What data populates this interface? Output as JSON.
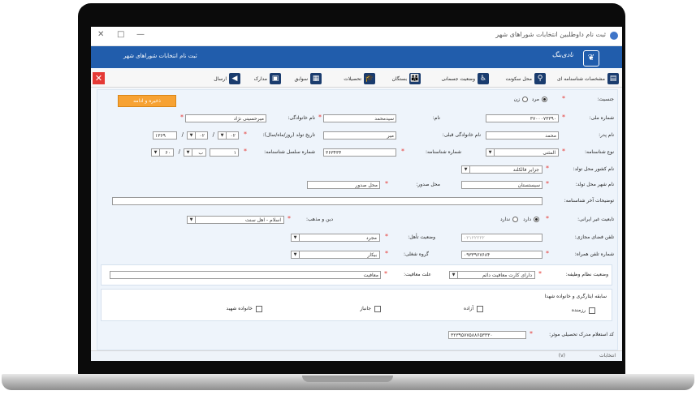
{
  "window": {
    "title": "ثبت نام داوطلبین انتخابات شوراهای شهر",
    "minimize": "—",
    "maximize": "□",
    "close": "✕"
  },
  "banner": {
    "title": "ثبت نام انتخابات شوراهای شهر",
    "logo_text": "نادی‌بنگ"
  },
  "tabs": [
    {
      "label": "مشخصات شناسنامه ای",
      "icon": "id-card-icon",
      "glyph": "▤"
    },
    {
      "label": "محل سکونت",
      "icon": "location-pin-icon",
      "glyph": "⚲"
    },
    {
      "label": "وضعیت جسمانی",
      "icon": "person-icon",
      "glyph": "♿"
    },
    {
      "label": "بستگان",
      "icon": "family-icon",
      "glyph": "👪"
    },
    {
      "label": "تحصیلات",
      "icon": "graduation-cap-icon",
      "glyph": "🎓"
    },
    {
      "label": "سوابق",
      "icon": "records-icon",
      "glyph": "▦"
    },
    {
      "label": "مدارک",
      "icon": "documents-icon",
      "glyph": "▣"
    },
    {
      "label": "ارسال",
      "icon": "send-icon",
      "glyph": "◀"
    }
  ],
  "close_form_label": "✕",
  "save_button": "ذخیره و ادامه",
  "fields": {
    "gender_label": "جنسیت:",
    "gender_male": "مرد",
    "gender_female": "زن",
    "national_id_label": "شماره ملی:",
    "national_id_value": "۳۷۰۰۰۷۳۳۹۰",
    "first_name_label": "نام:",
    "first_name_value": "سیدمحمد",
    "last_name_label": "نام خانوادگی:",
    "last_name_value": "میرحسینی نژاد",
    "father_name_label": "نام پدر:",
    "father_name_value": "محمد",
    "prev_last_name_label": "نام خانوادگی قبلی:",
    "prev_last_name_value": "میر",
    "birth_date_label": "تاریخ تولد (روز/ماه/سال):",
    "birth_day": "۰۲",
    "birth_month": "۰۲",
    "birth_year": "۱۳۶۹",
    "id_type_label": "نوع شناسنامه:",
    "id_type_value": "المثنی",
    "id_number_label": "شماره شناسنامه:",
    "id_number_value": "۳۶۳۴۳۴",
    "id_serial_label": "شماره سلسل شناسنامه:",
    "id_serial_part1": "۱",
    "id_serial_part2": "ب",
    "id_serial_part3": "۶۰",
    "birth_country_label": "نام کشور محل تولد:",
    "birth_country_value": "جزایر فالکلند",
    "birth_city_label": "نام شهر محل تولد:",
    "birth_city_value": "سیستستان",
    "issue_place_label": "محل صدور:",
    "issue_place_value": "محل صدور",
    "last_id_desc_label": "توضیحات آخر شناسنامه:",
    "foreign_nat_label": "تابعیت غیر ایرانی:",
    "has_label": "دارد",
    "hasnot_label": "ندارد",
    "religion_label": "دین و مذهب:",
    "religion_value": "اسلام - اهل سنت",
    "virtual_phone_label": "تلفن فضای مجازی:",
    "virtual_phone_value": "۰۲۱۲۲۲۲۲",
    "marital_label": "وضعیت تأهل:",
    "marital_value": "مجرد",
    "mobile_label": "شماره تلفن همراه:",
    "mobile_value": "۰۹۳۳۹۶۷۶۸۴",
    "job_group_label": "گروه شغلی:",
    "job_group_value": "بیکار",
    "service_label": "وضعیت نظام وظیفه:",
    "service_value": "دارای کارت معافیت دائم",
    "exemption_label": "علت معافیت:",
    "exemption_value": "معافیت",
    "sacrifice_label": "سابقه ایثارگری و خانواده شهدا",
    "warrior_label": "رزمنده",
    "freed_label": "آزاده",
    "veteran_label": "جانباز",
    "martyr_family_label": "خانواده شهید",
    "edu_code_label": "کد استعلام مدرک تحصیلی موثر:",
    "edu_code_value": "۳۲۳۹۵۷۷۵۸۸۶۵۳۳۳۰"
  },
  "status": {
    "version": "(v)",
    "right": "انتخابات"
  }
}
